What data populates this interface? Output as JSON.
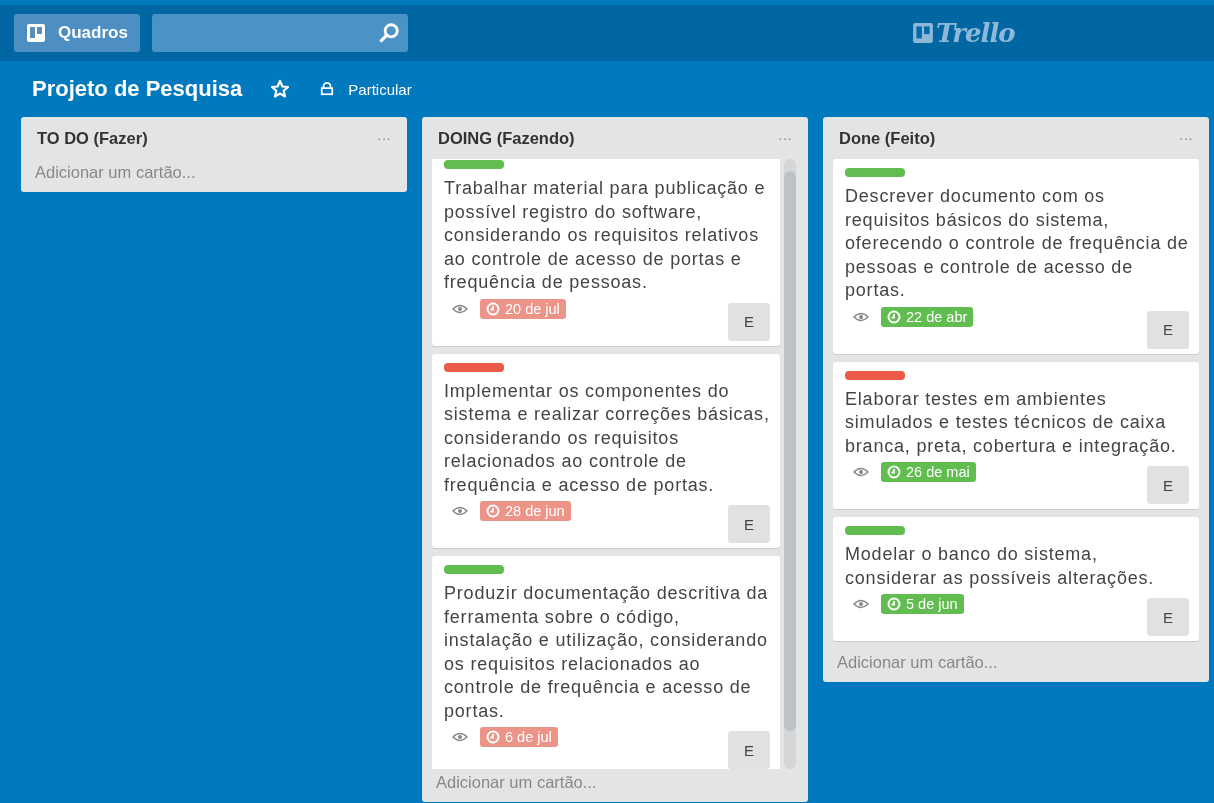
{
  "topbar": {
    "boards_button": "Quadros",
    "logo": "Trello"
  },
  "board": {
    "title": "Projeto de Pesquisa",
    "starred": false,
    "visibility": "Particular"
  },
  "lists": [
    {
      "title": "TO DO (Fazer)",
      "menu": "···",
      "add_card": "Adicionar um cartão..."
    },
    {
      "title": "DOING (Fazendo)",
      "menu": "···",
      "scrolled": true,
      "cards": [
        {
          "color": "#61bd4f",
          "text": "Trabalhar material para publicação e possível registro do software, considerando os requisitos relativos ao controle de acesso de portas e frequência de pessoas.",
          "watching": true,
          "due": {
            "text": "20 de jul",
            "complete": false
          },
          "member": "E"
        },
        {
          "color": "#eb5a46",
          "text": "Implementar os componentes do sistema e realizar correções básicas, considerando os requisitos relacionados ao controle de frequência e acesso de portas.",
          "watching": true,
          "due": {
            "text": "28 de jun",
            "complete": false
          },
          "member": "E"
        },
        {
          "color": "#61bd4f",
          "text": "Produzir documentação descritiva da ferramenta sobre o código, instalação e utilização, considerando os requisitos relacionados ao controle de frequência e acesso de portas.",
          "watching": true,
          "due": {
            "text": "6 de jul",
            "complete": false
          },
          "member": "E"
        }
      ],
      "add_card": "Adicionar um cartão..."
    },
    {
      "title": "Done (Feito)",
      "menu": "···",
      "scrolled": false,
      "cards": [
        {
          "color": "#61bd4f",
          "text": "Descrever documento com os requisitos básicos do sistema, oferecendo o controle de frequência de pessoas e controle de acesso de portas.",
          "watching": true,
          "due": {
            "text": "22 de abr",
            "complete": true
          },
          "member": "E"
        },
        {
          "color": "#eb5a46",
          "text": "Elaborar testes em ambientes simulados e testes técnicos de caixa branca, preta, cobertura e integração.",
          "watching": true,
          "due": {
            "text": "26 de mai",
            "complete": true
          },
          "member": "E"
        },
        {
          "color": "#61bd4f",
          "text": "Modelar o banco do sistema, considerar as possíveis alterações.",
          "watching": true,
          "due": {
            "text": "5 de jun",
            "complete": true
          },
          "member": "E"
        }
      ],
      "add_card": "Adicionar um cartão..."
    }
  ]
}
